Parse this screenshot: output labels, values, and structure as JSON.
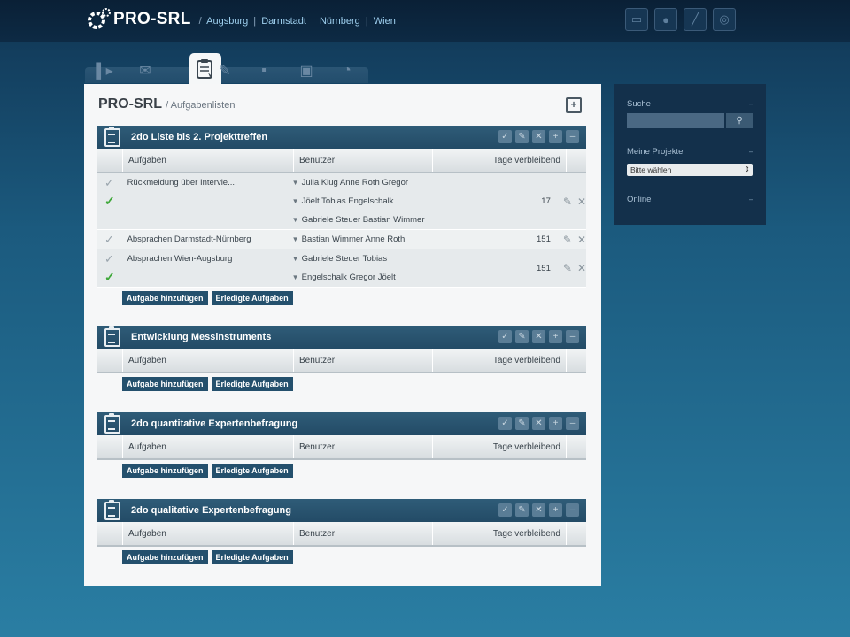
{
  "header": {
    "logo": "PRO-SRL",
    "cities": [
      "Augsburg",
      "Darmstadt",
      "Nürnberg",
      "Wien"
    ],
    "icons": [
      "chat-icon",
      "user-icon",
      "wrench-icon",
      "gear-icon"
    ]
  },
  "tabs": [
    {
      "name": "news",
      "glyph": "▌▸"
    },
    {
      "name": "mail",
      "glyph": "✉"
    },
    {
      "name": "tasks",
      "glyph": "📋",
      "active": true
    },
    {
      "name": "notes",
      "glyph": "✎"
    },
    {
      "name": "save",
      "glyph": "▪"
    },
    {
      "name": "archive",
      "glyph": "▣"
    },
    {
      "name": "stats",
      "glyph": "◔"
    }
  ],
  "page": {
    "title": "PRO-SRL",
    "subtitle": "/ Aufgabenlisten"
  },
  "columns": {
    "tasks": "Aufgaben",
    "users": "Benutzer",
    "days": "Tage verbleibend"
  },
  "buttons": {
    "add_task": "Aufgabe hinzufügen",
    "done_tasks": "Erledigte Aufgaben"
  },
  "lists": [
    {
      "title": "2do Liste bis 2. Projekttreffen",
      "rows": [
        {
          "task": "Rückmeldung über Intervie...",
          "users": [
            "Julia Klug Anne Roth Gregor",
            "Jöelt Tobias Engelschalk",
            "Gabriele Steuer Bastian Wimmer"
          ],
          "days": "17"
        },
        {
          "task": "Absprachen Darmstadt-Nürnberg",
          "users": [
            "Bastian Wimmer Anne Roth"
          ],
          "days": "151"
        },
        {
          "task": "Absprachen Wien-Augsburg",
          "users": [
            "Gabriele Steuer Tobias",
            "Engelschalk Gregor Jöelt"
          ],
          "days": "151"
        }
      ]
    },
    {
      "title": "Entwicklung Messinstruments",
      "rows": []
    },
    {
      "title": "2do quantitative Expertenbefragung",
      "rows": []
    },
    {
      "title": "2do qualitative Expertenbefragung",
      "rows": []
    }
  ],
  "sidebar": {
    "search_label": "Suche",
    "projects_label": "Meine Projekte",
    "project_select": "Bitte wählen",
    "online_label": "Online"
  }
}
